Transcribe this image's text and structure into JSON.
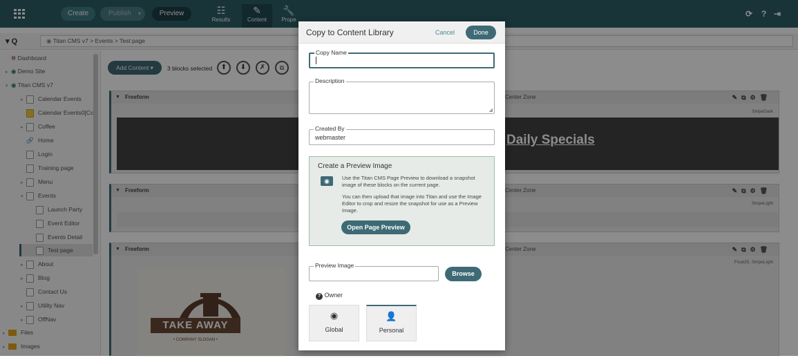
{
  "topbar": {
    "create": "Create",
    "publish": "Publish",
    "preview": "Preview",
    "tools": [
      {
        "label": "Results",
        "icon": "list-icon"
      },
      {
        "label": "Content",
        "icon": "edit-icon"
      },
      {
        "label": "Prope",
        "icon": "wrench-icon"
      }
    ],
    "right_icons": [
      "refresh-icon",
      "help-icon",
      "logout-icon"
    ],
    "help_glyph": "?"
  },
  "breadcrumb": {
    "site": "Titan CMS v7",
    "sep1": ">",
    "level2": "Events",
    "sep2": ">",
    "page": "Test page"
  },
  "sidebar": {
    "items": [
      {
        "label": "Dashboard"
      },
      {
        "label": "Demo Site"
      },
      {
        "label": "Titan CMS v7"
      },
      {
        "label": "Calendar Events"
      },
      {
        "label": "Calendar Events0[Cc"
      },
      {
        "label": "Coffee"
      },
      {
        "label": "Home"
      },
      {
        "label": "Login"
      },
      {
        "label": "Training page"
      },
      {
        "label": "Menu"
      },
      {
        "label": "Events"
      },
      {
        "label": "Launch Party"
      },
      {
        "label": "Event Editor"
      },
      {
        "label": "Events Detail"
      },
      {
        "label": "Test page"
      },
      {
        "label": "About"
      },
      {
        "label": "Blog"
      },
      {
        "label": "Contact Us"
      },
      {
        "label": "Utility Nav"
      },
      {
        "label": "OffNav"
      },
      {
        "label": "Files"
      },
      {
        "label": "Images"
      }
    ]
  },
  "main": {
    "add_content": "Add Content",
    "blocks_selected": "3 blocks selected",
    "zones": [
      {
        "title": "Freeform",
        "zone": "Center Zone",
        "stripe": "StripeDark",
        "banner": "Daily Specials"
      },
      {
        "title": "Freeform",
        "zone": "Center Zone",
        "stripe": "StripeLight"
      },
      {
        "title": "Freeform",
        "zone": "Center Zone",
        "stripe": "Float25, StripeLight"
      }
    ],
    "logo_text": "TAKE AWAY",
    "logo_slogan": "• COMPANY SLOGAN •"
  },
  "modal": {
    "title": "Copy to Content Library",
    "cancel": "Cancel",
    "done": "Done",
    "copy_name_label": "Copy Name",
    "copy_name_value": "",
    "description_label": "Description",
    "description_value": "",
    "created_by_label": "Created By",
    "created_by_value": "webmaster",
    "preview_title": "Create a Preview Image",
    "preview_text1": "Use the Titan CMS Page Preview to download a snapshot image of these blocks on the current page.",
    "preview_text2": "You can then upload that image into Titan and use the Image Editor to crop and resize the snapshot for use as a Preview Image.",
    "open_preview": "Open Page Preview",
    "preview_image_label": "Preview Image",
    "browse": "Browse",
    "owner_label": "Owner",
    "owner_global": "Global",
    "owner_personal": "Personal"
  },
  "colors": {
    "teal": "#2d5f68",
    "accent": "#3e6a75"
  }
}
